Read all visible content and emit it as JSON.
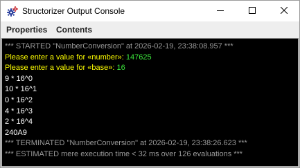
{
  "window": {
    "title": "Structorizer Output Console",
    "icon": "structorizer-gear-icon",
    "controls": [
      "minimize-icon",
      "maximize-icon",
      "close-icon"
    ]
  },
  "menu": {
    "items": [
      "Properties",
      "Contents"
    ]
  },
  "console": {
    "colors": {
      "background": "#000000",
      "meta": "#9a9a9a",
      "prompt": "#ffff00",
      "input": "#3be63b",
      "output": "#ffffff"
    },
    "started": "*** STARTED \"NumberConversion\" at 2026-02-19, 23:38:08.957 ***",
    "prompt_number": "Please enter a value for «number»: ",
    "input_number": "147625",
    "prompt_base": "Please enter a value for «base»: ",
    "input_base": "16",
    "output_lines": [
      "9 * 16^0",
      "10 * 16^1",
      "0 * 16^2",
      "4 * 16^3",
      "2 * 16^4",
      "240A9"
    ],
    "terminated": "*** TERMINATED \"NumberConversion\" at 2026-02-19, 23:38:26.623 ***",
    "estimated": "*** ESTIMATED mere execution time < 32 ms over 126 evaluations ***"
  }
}
